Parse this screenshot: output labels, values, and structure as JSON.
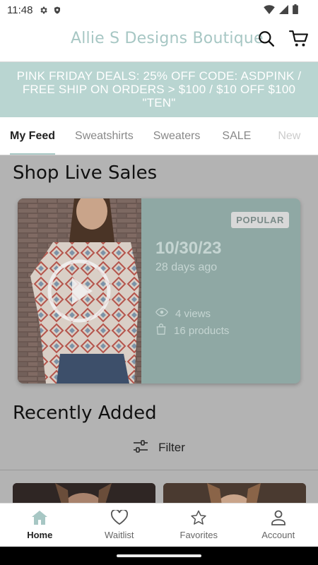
{
  "status_bar": {
    "time": "11:48",
    "icons": [
      "gear-icon",
      "shield-icon",
      "wifi-icon",
      "signal-icon",
      "battery-icon"
    ]
  },
  "header": {
    "brand": "Allie S Designs Boutique",
    "accent_color": "#a7c7c4",
    "icons": [
      "search-icon",
      "cart-icon"
    ]
  },
  "promo": {
    "text": "PINK FRIDAY DEALS: 25% OFF CODE: ASDPINK / FREE SHIP ON ORDERS > $100 / $10 OFF $100 \"TEN\"",
    "background": "#b9d5d1"
  },
  "tabs": [
    {
      "label": "My Feed",
      "active": true
    },
    {
      "label": "Sweatshirts",
      "active": false
    },
    {
      "label": "Sweaters",
      "active": false
    },
    {
      "label": "SALE",
      "active": false
    },
    {
      "label": "New",
      "active": false
    }
  ],
  "live_sales": {
    "title": "Shop Live Sales",
    "card": {
      "badge": "POPULAR",
      "date": "10/30/23",
      "ago": "28 days ago",
      "views": "4 views",
      "products": "16 products"
    }
  },
  "recently_added": {
    "title": "Recently Added",
    "filter_label": "Filter"
  },
  "bottom_nav": [
    {
      "label": "Home",
      "icon": "home-icon",
      "active": true
    },
    {
      "label": "Waitlist",
      "icon": "heart-icon",
      "active": false
    },
    {
      "label": "Favorites",
      "icon": "star-icon",
      "active": false
    },
    {
      "label": "Account",
      "icon": "person-icon",
      "active": false
    }
  ]
}
